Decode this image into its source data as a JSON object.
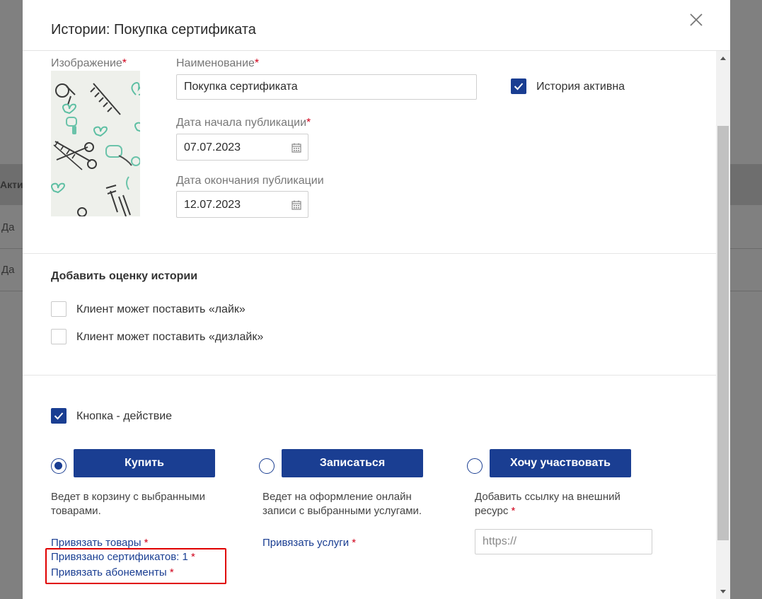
{
  "background": {
    "column_label": "Акти",
    "rows": [
      "Да",
      "Да"
    ]
  },
  "modal": {
    "title": "Истории: Покупка сертификата",
    "close_icon": "close-icon"
  },
  "form": {
    "image_label": "Изображение",
    "name_label": "Наименование",
    "name_value": "Покупка сертификата",
    "active_label": "История активна",
    "active_checked": true,
    "start_label": "Дата начала публикации",
    "start_value": "07.07.2023",
    "end_label": "Дата окончания публикации",
    "end_value": "12.07.2023",
    "required_mark": "*"
  },
  "rating": {
    "title": "Добавить оценку истории",
    "like_label": "Клиент может поставить «лайк»",
    "dislike_label": "Клиент может поставить «дизлайк»"
  },
  "action": {
    "toggle_label": "Кнопка - действие",
    "options": [
      {
        "button": "Купить",
        "selected": true,
        "description": "Ведет в корзину с выбранными товарами.",
        "desc_lines": [
          "Ведет в корзину с выбранными",
          "товарами."
        ],
        "links": [
          "Привязать товары",
          "Привязано сертификатов: 1",
          "Привязать абонементы"
        ]
      },
      {
        "button": "Записаться",
        "selected": false,
        "desc_lines": [
          "Ведет на оформление онлайн",
          "записи с выбранными услугами."
        ],
        "links": [
          "Привязать услуги"
        ]
      },
      {
        "button": "Хочу участвовать",
        "selected": false,
        "desc_lines": [
          "Добавить ссылку на внешний",
          "ресурс"
        ],
        "url_placeholder": "https://"
      }
    ]
  },
  "colors": {
    "primary": "#1a3e92",
    "required": "#d0021b",
    "highlight": "#e00000"
  }
}
